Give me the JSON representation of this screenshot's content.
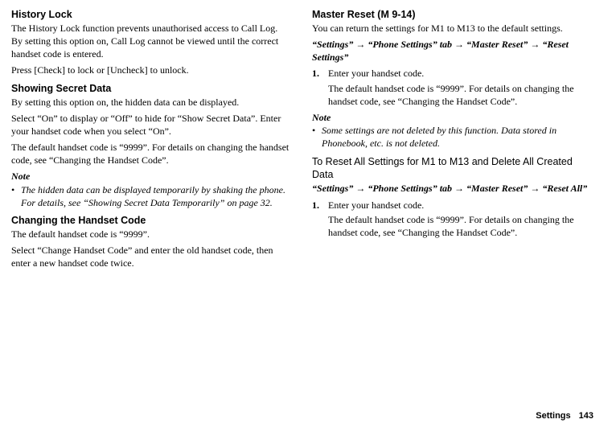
{
  "left": {
    "h1": "History Lock",
    "p1": "The History Lock function prevents unauthorised access to Call Log. By setting this option on, Call Log cannot be viewed until the correct handset code is entered.",
    "p2": "Press [Check] to lock or [Uncheck] to unlock.",
    "h2": "Showing Secret Data",
    "p3": "By setting this option on, the hidden data can be displayed.",
    "p4": "Select “On” to display or “Off” to hide for “Show Secret Data”. Enter your handset code when you select “On”.",
    "p5": "The default handset code is “9999”. For details on changing the handset code, see “Changing the Handset Code”.",
    "note_label": "Note",
    "note_bullet": "The hidden data can be displayed temporarily by shaking the phone. For details, see “Showing Secret Data Temporarily” on page 32.",
    "h3": "Changing the Handset Code",
    "p6": "The default handset code is “9999”.",
    "p7": "Select “Change Handset Code” and enter the old handset code, then enter a new handset code twice."
  },
  "right": {
    "h1": "Master Reset",
    "menu_code": " (M 9-14)",
    "p1": "You can return the settings for M1 to M13 to the default settings.",
    "path1": "“Settings” → “Phone Settings” tab → “Master Reset” → “Reset Settings”",
    "step1_num": "1.",
    "step1_txt": "Enter your handset code.",
    "step1_sub": "The default handset code is “9999”. For details on changing the handset code, see “Changing the Handset Code”.",
    "note_label": "Note",
    "note_bullet": "Some settings are not deleted by this function. Data stored in Phonebook, etc. is not deleted.",
    "sub_h": "To Reset All Settings for M1 to M13 and Delete All Created Data",
    "path2": "“Settings” → “Phone Settings” tab → “Master Reset” → “Reset All”",
    "step2_num": "1.",
    "step2_txt": "Enter your handset code.",
    "step2_sub": "The default handset code is “9999”. For details on changing the handset code, see “Changing the Handset Code”."
  },
  "footer": {
    "section": "Settings",
    "page": "143"
  }
}
